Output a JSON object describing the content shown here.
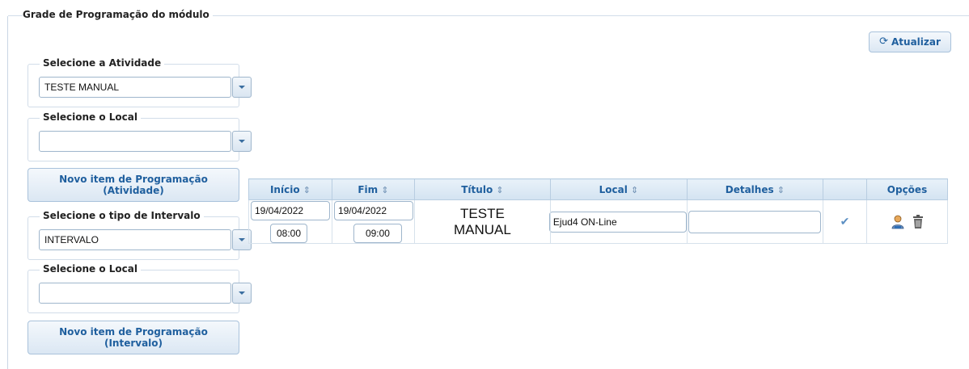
{
  "module": {
    "title": "Grade de Programação do módulo"
  },
  "toolbar": {
    "refresh_label": "Atualizar",
    "refresh_icon": "refresh-icon"
  },
  "activity": {
    "legend": "Selecione a Atividade",
    "selected": "TESTE MANUAL"
  },
  "local1": {
    "legend": "Selecione o Local",
    "selected": ""
  },
  "new_activity_button": {
    "line1": "Novo item de Programação",
    "line2": "(Atividade)"
  },
  "interval": {
    "legend": "Selecione o tipo de Intervalo",
    "selected": "INTERVALO"
  },
  "local2": {
    "legend": "Selecione o Local",
    "selected": ""
  },
  "new_interval_button": {
    "line1": "Novo item de Programação",
    "line2": "(Intervalo)"
  },
  "table": {
    "headers": {
      "inicio": "Início",
      "fim": "Fim",
      "titulo": "Título",
      "local": "Local",
      "detalhes": "Detalhes",
      "opcoes": "Opções"
    },
    "rows": [
      {
        "inicio_date": "19/04/2022",
        "inicio_time": "08:00",
        "fim_date": "19/04/2022",
        "fim_time": "09:00",
        "titulo_line1": "TESTE",
        "titulo_line2": "MANUAL",
        "local": "Ejud4 ON-Line",
        "detalhes": ""
      }
    ]
  },
  "colors": {
    "accent": "#1f5f9e",
    "header_bg": "#d3e3f1",
    "border": "#b8cde1"
  }
}
